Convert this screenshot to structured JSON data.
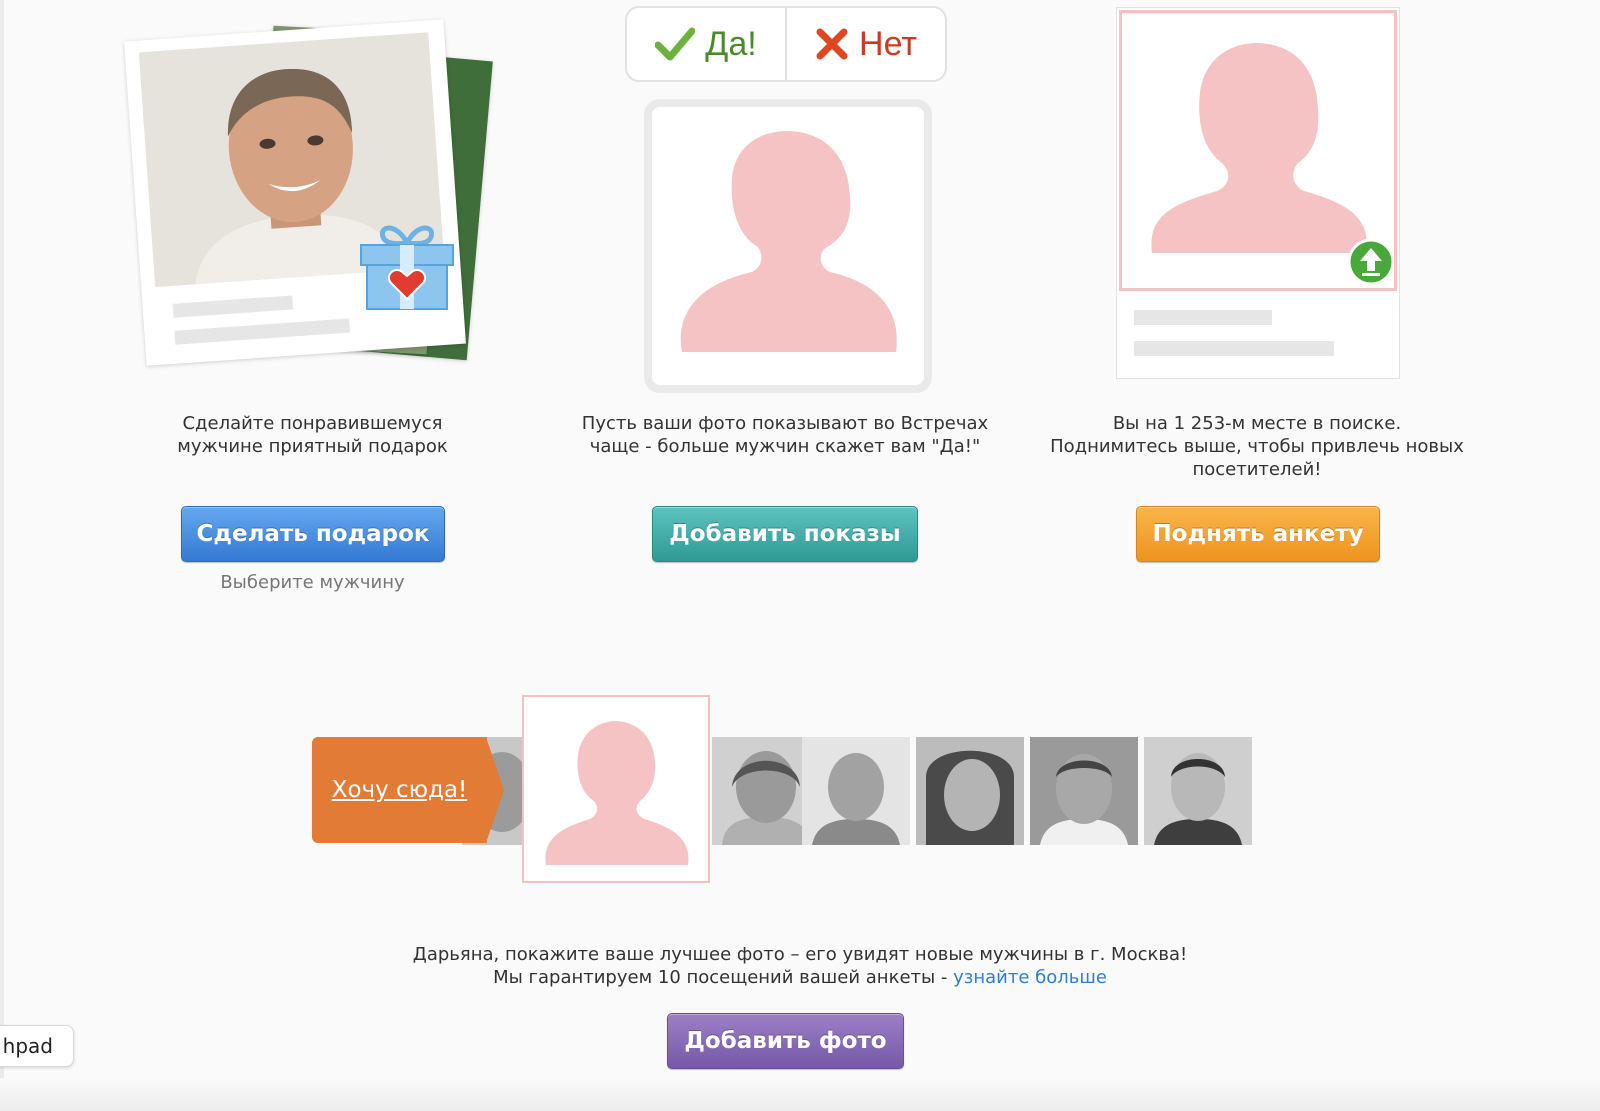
{
  "gift": {
    "description_line1": "Сделайте понравившемуся",
    "description_line2": "мужчине приятный подарок",
    "button": "Сделать подарок",
    "hint": "Выберите мужчину"
  },
  "encounters": {
    "yes_label": "Да!",
    "no_label": "Нет",
    "description_line1": "Пусть ваши фото показывают во Встречах",
    "description_line2": "чаще - больше мужчин скажет вам \"Да!\"",
    "button": "Добавить показы"
  },
  "raise": {
    "description_line1": "Вы на 1 253-м месте в поиске.",
    "description_line2": "Поднимитесь выше, чтобы привлечь новых",
    "description_line3": "посетителей!",
    "button": "Поднять анкету"
  },
  "spotlight": {
    "want_here": "Хочу сюда!",
    "text_line1": "Дарьяна, покажите ваше лучшее фото – его увидят новые мужчины в г. Москва!",
    "text_line2": "Мы гарантируем 10 посещений вашей анкеты - ",
    "learn_more": "узнайте больше",
    "button": "Добавить фото"
  },
  "touchpad_label": "hpad",
  "colors": {
    "silhouette": "#f5c3c3",
    "accent_blue": "#3f8ad8",
    "accent_teal": "#3aa9a3",
    "accent_orange": "#f0a030",
    "accent_purple": "#8266b5",
    "want_orange": "#e27b36",
    "link": "#2f7fd0"
  }
}
